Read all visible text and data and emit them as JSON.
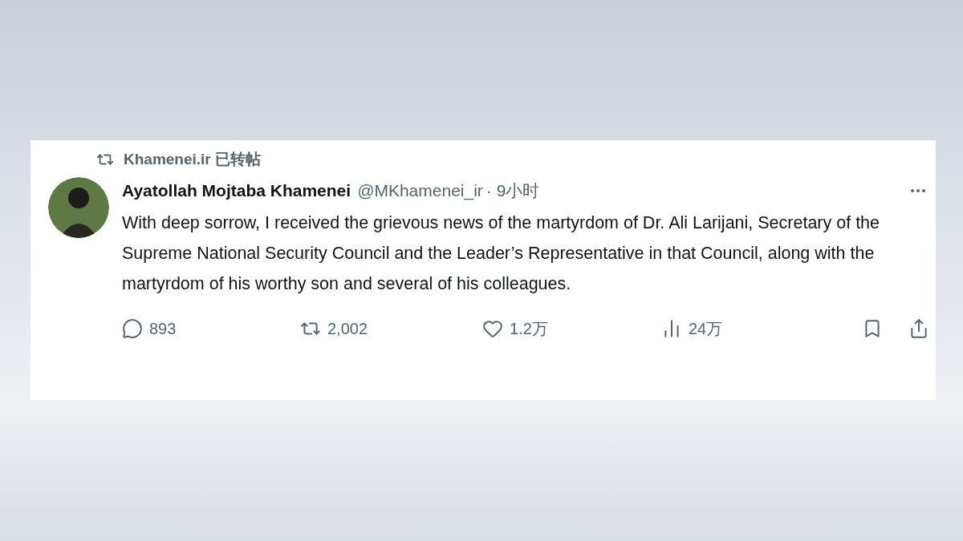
{
  "retweet": {
    "label": "Khamenei.ir 已转帖"
  },
  "tweet": {
    "author": "Ayatollah Mojtaba Khamenei",
    "handle": "@MKhamenei_ir",
    "time": "· 9小时",
    "body": "With deep sorrow, I received the grievous news of the martyrdom of Dr. Ali Larijani, Secretary of the Supreme National Security Council and the Leader’s Representative in that Council, along with the martyrdom of his worthy son and several of his colleagues.",
    "stats": [
      {
        "kind": "reply",
        "count": "893"
      },
      {
        "kind": "retweet",
        "count": "2,002"
      },
      {
        "kind": "like",
        "count": "1.2万"
      },
      {
        "kind": "views",
        "count": "24万"
      }
    ]
  }
}
